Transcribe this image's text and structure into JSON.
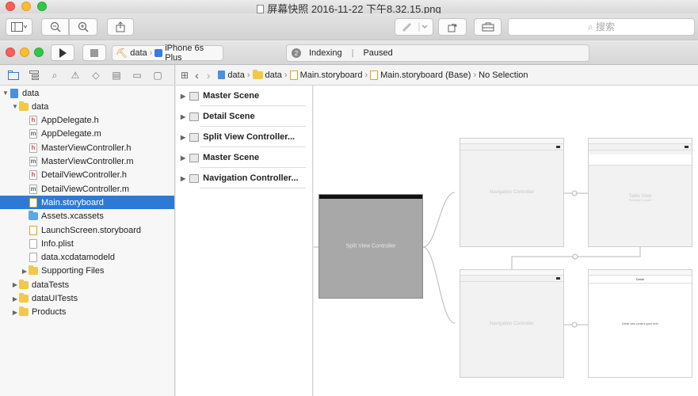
{
  "window": {
    "title": "屏幕快照 2016-11-22 下午8.32.15.png",
    "search_placeholder": "搜索"
  },
  "run": {
    "scheme_target": "data",
    "scheme_device": "iPhone 6s Plus",
    "activity_count": "2",
    "activity_left": "Indexing",
    "activity_right": "Paused"
  },
  "navigator": {
    "items": [
      {
        "label": "data",
        "kind": "project",
        "depth": 0,
        "expanded": true
      },
      {
        "label": "data",
        "kind": "folder",
        "depth": 1,
        "expanded": true
      },
      {
        "label": "AppDelegate.h",
        "kind": "h",
        "depth": 2
      },
      {
        "label": "AppDelegate.m",
        "kind": "m",
        "depth": 2
      },
      {
        "label": "MasterViewController.h",
        "kind": "h",
        "depth": 2
      },
      {
        "label": "MasterViewController.m",
        "kind": "m",
        "depth": 2
      },
      {
        "label": "DetailViewController.h",
        "kind": "h",
        "depth": 2
      },
      {
        "label": "DetailViewController.m",
        "kind": "m",
        "depth": 2
      },
      {
        "label": "Main.storyboard",
        "kind": "storyboard",
        "depth": 2,
        "selected": true
      },
      {
        "label": "Assets.xcassets",
        "kind": "assets",
        "depth": 2
      },
      {
        "label": "LaunchScreen.storyboard",
        "kind": "storyboard",
        "depth": 2
      },
      {
        "label": "Info.plist",
        "kind": "plist",
        "depth": 2
      },
      {
        "label": "data.xcdatamodeld",
        "kind": "model",
        "depth": 2
      },
      {
        "label": "Supporting Files",
        "kind": "folder",
        "depth": 2,
        "collapsed": true
      },
      {
        "label": "dataTests",
        "kind": "folder",
        "depth": 1,
        "collapsed": true
      },
      {
        "label": "dataUITests",
        "kind": "folder",
        "depth": 1,
        "collapsed": true
      },
      {
        "label": "Products",
        "kind": "folder",
        "depth": 1,
        "collapsed": true
      }
    ]
  },
  "jumpbar": {
    "crumbs": [
      "data",
      "data",
      "Main.storyboard",
      "Main.storyboard (Base)",
      "No Selection"
    ]
  },
  "outline": {
    "scenes": [
      "Master Scene",
      "Detail Scene",
      "Split View Controller...",
      "Master Scene",
      "Navigation Controller..."
    ]
  },
  "canvas": {
    "split_view_controller": "Split View Controller",
    "navigation_controller_top": "Navigation Controller",
    "table_view_title": "Table View",
    "table_view_subtitle": "Prototype Content",
    "navigation_controller_bottom": "Navigation Controller",
    "detail_title": "Detail",
    "detail_body": "Detail view content goes here"
  }
}
